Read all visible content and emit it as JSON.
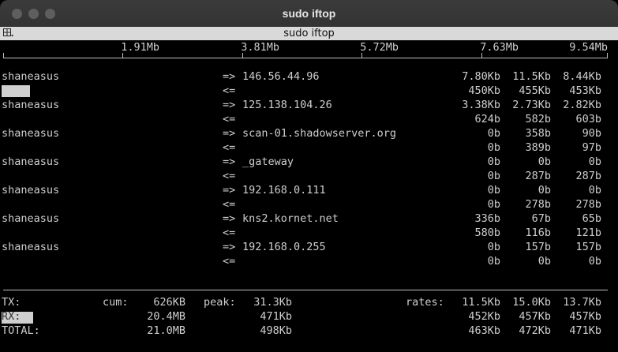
{
  "window": {
    "title": "sudo iftop",
    "tab_title": "sudo iftop"
  },
  "scale": [
    "1.91Mb",
    "3.81Mb",
    "5.72Mb",
    "7.63Mb",
    "9.54Mb"
  ],
  "flows": [
    {
      "host": "shaneasus",
      "out_arrow": "=>",
      "in_arrow": "<=",
      "peer": "146.56.44.96",
      "out": [
        "7.80Kb",
        "11.5Kb",
        "8.44Kb"
      ],
      "in": [
        "450Kb",
        "455Kb",
        "453Kb"
      ]
    },
    {
      "host": "shaneasus",
      "out_arrow": "=>",
      "in_arrow": "<=",
      "peer": "125.138.104.26",
      "out": [
        "3.38Kb",
        "2.73Kb",
        "2.82Kb"
      ],
      "in": [
        "624b",
        "582b",
        "603b"
      ]
    },
    {
      "host": "shaneasus",
      "out_arrow": "=>",
      "in_arrow": "<=",
      "peer": "scan-01.shadowserver.org",
      "out": [
        "0b",
        "358b",
        "90b"
      ],
      "in": [
        "0b",
        "389b",
        "97b"
      ]
    },
    {
      "host": "shaneasus",
      "out_arrow": "=>",
      "in_arrow": "<=",
      "peer": "_gateway",
      "out": [
        "0b",
        "0b",
        "0b"
      ],
      "in": [
        "0b",
        "287b",
        "287b"
      ]
    },
    {
      "host": "shaneasus",
      "out_arrow": "=>",
      "in_arrow": "<=",
      "peer": "192.168.0.111",
      "out": [
        "0b",
        "0b",
        "0b"
      ],
      "in": [
        "0b",
        "278b",
        "278b"
      ]
    },
    {
      "host": "shaneasus",
      "out_arrow": "=>",
      "in_arrow": "<=",
      "peer": "kns2.kornet.net",
      "out": [
        "336b",
        "67b",
        "65b"
      ],
      "in": [
        "580b",
        "116b",
        "121b"
      ]
    },
    {
      "host": "shaneasus",
      "out_arrow": "=>",
      "in_arrow": "<=",
      "peer": "192.168.0.255",
      "out": [
        "0b",
        "157b",
        "157b"
      ],
      "in": [
        "0b",
        "0b",
        "0b"
      ]
    }
  ],
  "first_row_bar_fraction": 0.047,
  "totals": {
    "tx_label": "TX:",
    "rx_label": "RX:",
    "total_label": "TOTAL:",
    "cum_label": "cum:",
    "peak_label": "peak:",
    "rates_label": "rates:",
    "tx": {
      "cum": "626KB",
      "peak": "31.3Kb",
      "rates": [
        "11.5Kb",
        "15.0Kb",
        "13.7Kb"
      ]
    },
    "rx": {
      "cum": "20.4MB",
      "peak": "471Kb",
      "rates": [
        "452Kb",
        "457Kb",
        "457Kb"
      ]
    },
    "total": {
      "cum": "21.0MB",
      "peak": "498Kb",
      "rates": [
        "463Kb",
        "472Kb",
        "471Kb"
      ]
    }
  }
}
